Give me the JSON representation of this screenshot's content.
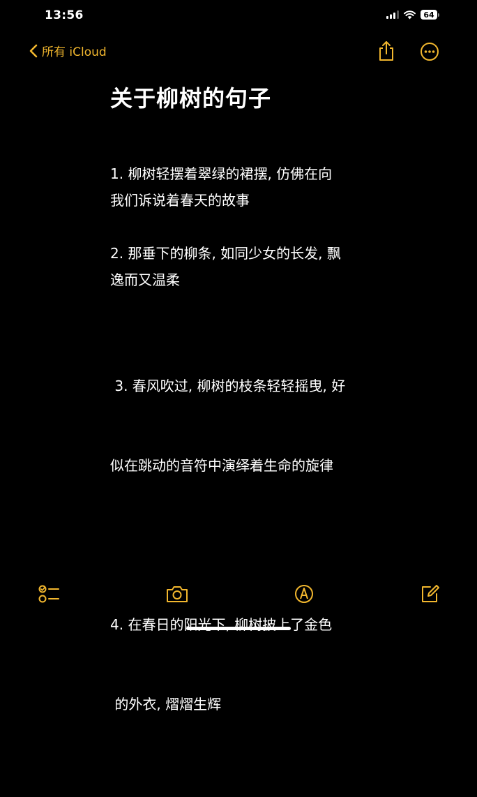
{
  "status_bar": {
    "time": "13:56",
    "battery": "64"
  },
  "nav": {
    "back_label": "所有 iCloud",
    "icons": {
      "back": "chevron-left-icon",
      "share": "share-icon",
      "more": "ellipsis-circle-icon"
    }
  },
  "note": {
    "title": "关于柳树的句子",
    "paragraphs": [
      {
        "lines": [
          "1. 柳树轻摆着翠绿的裙摆, 仿佛在向",
          "我们诉说着春天的故事"
        ]
      },
      {
        "lines": [
          "2. 那垂下的柳条, 如同少女的长发, 飘",
          "逸而又温柔"
        ]
      },
      {
        "lines": [
          " 3. 春风吹过, 柳树的枝条轻轻摇曳, 好",
          "似在跳动的音符中演绎着生命的旋律"
        ]
      },
      {
        "lines": [
          "4. 在春日的阳光下, 柳树披上了金色",
          " 的外衣, 熠熠生辉"
        ]
      }
    ]
  },
  "toolbar": {
    "icons": [
      "checklist-icon",
      "camera-icon",
      "markup-pen-icon",
      "compose-icon"
    ]
  },
  "colors": {
    "accent": "#f2b72e",
    "background": "#000000",
    "text": "#ffffff"
  }
}
